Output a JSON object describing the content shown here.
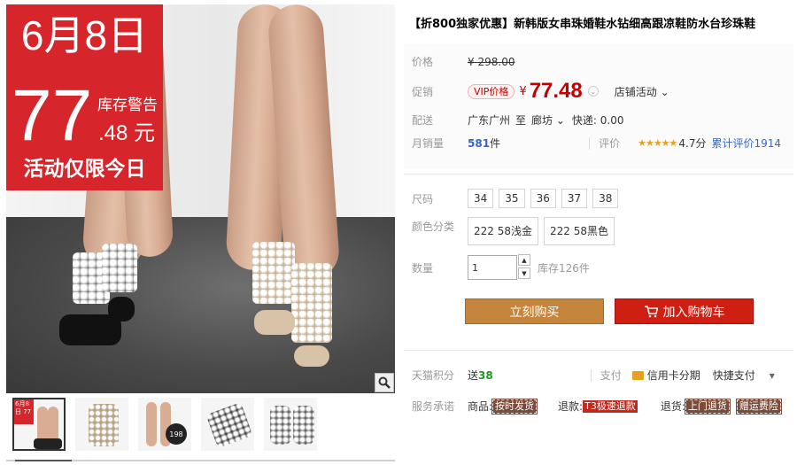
{
  "promo": {
    "date": "6月8日",
    "price_int": "77",
    "stock_alert": "库存警告",
    "price_cents": ".48 元",
    "tagline": "活动仅限今日"
  },
  "thumbs": [
    {
      "promo_text": "6月8日 77",
      "badge": ""
    },
    {
      "promo_text": "",
      "badge": ""
    },
    {
      "promo_text": "",
      "badge": "198"
    },
    {
      "promo_text": "",
      "badge": ""
    },
    {
      "promo_text": "",
      "badge": ""
    }
  ],
  "product": {
    "title": "【折800独家优惠】新韩版女串珠婚鞋水钻细高跟凉鞋防水台珍珠鞋"
  },
  "price": {
    "label": "价格",
    "currency": "¥",
    "original": "298.00"
  },
  "promo_price": {
    "label": "促销",
    "vip": "VIP价格",
    "currency": "¥",
    "value": "77.48",
    "store_activity": "店铺活动"
  },
  "shipping": {
    "label": "配送",
    "from": "广东广州",
    "to_word": "至",
    "to": "廊坊",
    "express": "快递: 0.00"
  },
  "sales": {
    "label": "月销量",
    "count": "581",
    "unit": "件",
    "rating_label": "评价",
    "stars": "★★★★★",
    "score": "4.7分",
    "reviews": "累计评价1914"
  },
  "options": {
    "size_label": "尺码",
    "sizes": [
      "34",
      "35",
      "36",
      "37",
      "38"
    ],
    "color_label": "颜色分类",
    "colors": [
      "222 58浅金",
      "222 58黑色"
    ],
    "qty_label": "数量",
    "qty_value": "1",
    "stock": "库存126件"
  },
  "actions": {
    "buy": "立刻购买",
    "cart": "加入购物车"
  },
  "points": {
    "label": "天猫积分",
    "send": "送",
    "value": "38",
    "pay_label": "支付",
    "installment": "信用卡分期",
    "quick_pay": "快捷支付"
  },
  "service": {
    "label": "服务承诺",
    "goods": "商品:",
    "goods_tag": "按时发货",
    "refund": "退款:",
    "refund_tag": "T3极速退款",
    "return": "退货:",
    "return_tag": "上门退货",
    "gift_tag": "赠运费险"
  },
  "colors": {
    "accent_red": "#c40000",
    "promo_red": "#d7262b",
    "buy_button": "#c6853d",
    "cart_button": "#cf1e12"
  }
}
